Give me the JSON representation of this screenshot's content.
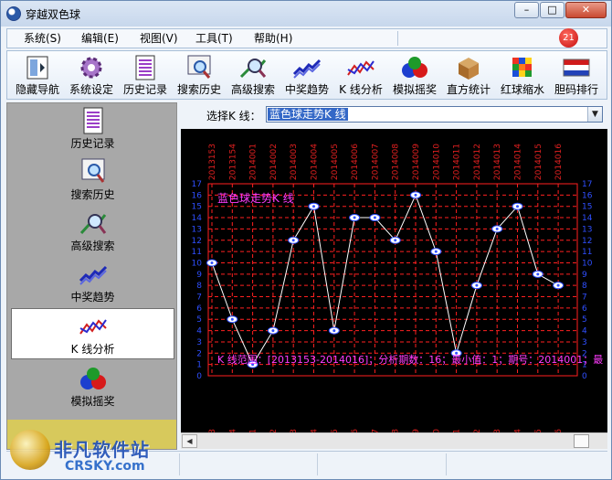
{
  "window": {
    "title": "穿越双色球"
  },
  "window_controls": {
    "min": "–",
    "max": "□",
    "close": "✕"
  },
  "menu": [
    "系统(S)",
    "编辑(E)",
    "视图(V)",
    "工具(T)",
    "帮助(H)"
  ],
  "notification_count": "21",
  "toolbar": [
    {
      "label": "隐藏导航",
      "icon": "hide-nav-icon"
    },
    {
      "label": "系统设定",
      "icon": "gear-icon"
    },
    {
      "label": "历史记录",
      "icon": "history-list-icon"
    },
    {
      "label": "搜索历史",
      "icon": "search-history-icon"
    },
    {
      "label": "高级搜索",
      "icon": "advanced-search-icon"
    },
    {
      "label": "中奖趋势",
      "icon": "trend-icon"
    },
    {
      "label": "K 线分析",
      "icon": "kline-icon"
    },
    {
      "label": "模拟摇奖",
      "icon": "lottery-balls-icon"
    },
    {
      "label": "直方统计",
      "icon": "box-icon"
    },
    {
      "label": "红球缩水",
      "icon": "cube-icon"
    },
    {
      "label": "胆码排行",
      "icon": "flag-icon"
    }
  ],
  "sidebar": [
    {
      "label": "历史记录",
      "icon": "history-list-icon"
    },
    {
      "label": "搜索历史",
      "icon": "search-history-icon"
    },
    {
      "label": "高级搜索",
      "icon": "advanced-search-icon"
    },
    {
      "label": "中奖趋势",
      "icon": "trend-icon"
    },
    {
      "label": "K 线分析",
      "icon": "kline-icon",
      "active": true
    },
    {
      "label": "模拟摇奖",
      "icon": "lottery-balls-icon"
    }
  ],
  "select": {
    "label": "选择K 线：",
    "value": "蓝色球走势K 线"
  },
  "watermark": {
    "text": "非凡软件站",
    "sub": "CRSKY.com"
  },
  "colors": {
    "chart_bg": "#000000",
    "grid": "#ff2020",
    "label_red": "#e02020",
    "axis_blue": "#2f4fff",
    "title_magenta": "#ff3cff",
    "line": "#ffffff",
    "select_highlight": "#3468c7"
  },
  "chart_data": {
    "type": "line",
    "title": "蓝色球走势K 线",
    "annotation": "K 线范围：[2013153-2014016]；分析期数：16；最小值：1；期号：2014001；最",
    "x": [
      "2013153",
      "2013154",
      "2014001",
      "2014002",
      "2014003",
      "2014004",
      "2014005",
      "2014006",
      "2014007",
      "2014008",
      "2014009",
      "2014010",
      "2014011",
      "2014012",
      "2014013",
      "2014014",
      "2014015",
      "2014016"
    ],
    "values": [
      10,
      5,
      1,
      4,
      12,
      15,
      4,
      14,
      14,
      12,
      16,
      11,
      2,
      8,
      13,
      15,
      9,
      8
    ],
    "ylim": [
      0,
      17
    ],
    "y_ticks": [
      0,
      1,
      2,
      3,
      4,
      5,
      6,
      7,
      8,
      9,
      10,
      11,
      12,
      13,
      14,
      15,
      16,
      17
    ],
    "grid": true
  }
}
